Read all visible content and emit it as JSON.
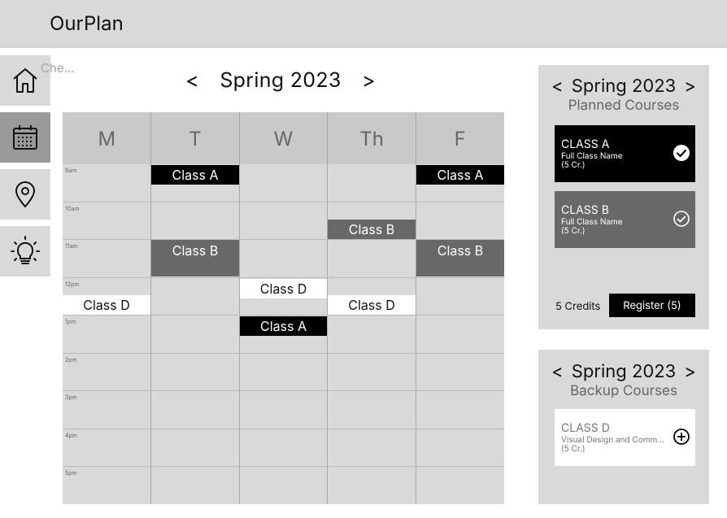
{
  "app": {
    "title": "OurPlan"
  },
  "tooltip": "Che...",
  "nav": [
    "home-icon",
    "calendar-icon",
    "location-pin-icon",
    "lightbulb-icon"
  ],
  "schedule": {
    "term": "Spring 2023",
    "prev": "<",
    "next": ">",
    "days": [
      "M",
      "T",
      "W",
      "Th",
      "F"
    ],
    "times": [
      "9am",
      "10am",
      "11am",
      "12pm",
      "1pm",
      "2pm",
      "3pm",
      "4pm",
      "5pm"
    ],
    "blocks": [
      {
        "label": "Class A",
        "day": "T",
        "start": "9:00"
      },
      {
        "label": "Class A",
        "day": "F",
        "start": "9:00"
      },
      {
        "label": "Class B",
        "day": "Th",
        "start": "10:30"
      },
      {
        "label": "Class B",
        "day": "T",
        "start": "11:00"
      },
      {
        "label": "Class B",
        "day": "F",
        "start": "11:00"
      },
      {
        "label": "Class D",
        "day": "W",
        "start": "12:00"
      },
      {
        "label": "Class D",
        "day": "M",
        "start": "12:30"
      },
      {
        "label": "Class D",
        "day": "Th",
        "start": "12:30"
      },
      {
        "label": "Class A",
        "day": "W",
        "start": "1:00"
      }
    ]
  },
  "planned": {
    "term": "Spring 2023",
    "prev": "<",
    "next": ">",
    "subtitle": "Planned Courses",
    "courses": [
      {
        "code": "CLASS A",
        "name": "Full Class Name",
        "credits": "(5 Cr.)"
      },
      {
        "code": "CLASS B",
        "name": "Full Class Name",
        "credits": "(5 Cr.)"
      }
    ],
    "credits_label": "5 Credits",
    "register_label": "Register (5)"
  },
  "backup": {
    "term": "Spring 2023",
    "prev": "<",
    "next": ">",
    "subtitle": "Backup Courses",
    "courses": [
      {
        "code": "CLASS D",
        "name": "Visual Design and Commu...",
        "credits": "(5 Cr.)"
      }
    ]
  },
  "colors": {
    "class_a": "#000000",
    "class_b": "#686868",
    "class_d": "#ffffff",
    "panel": "#d9d9d9"
  }
}
